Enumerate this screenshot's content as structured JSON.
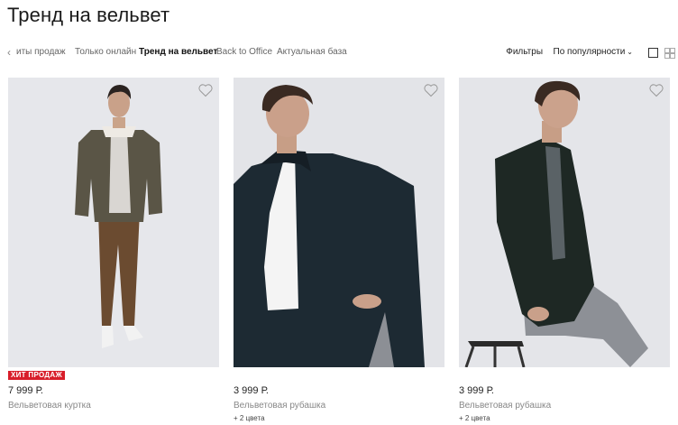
{
  "page": {
    "title": "Тренд на вельвет"
  },
  "tabs": [
    {
      "label": "иты продаж",
      "active": false
    },
    {
      "label": "Только онлайн",
      "active": false
    },
    {
      "label": "Тренд на вельвет",
      "active": true
    },
    {
      "label": "Back to Office",
      "active": false
    },
    {
      "label": "Актуальная база",
      "active": false
    }
  ],
  "icons": {
    "tabs_prev": "chevron-left-icon",
    "sort": "chevron-down-icon",
    "favorite": "heart-icon"
  },
  "controls": {
    "filters_label": "Фильтры",
    "sort_label": "По популярности",
    "view_single": "grid-one-icon",
    "view_multi": "grid-four-icon"
  },
  "products": [
    {
      "badge": "ХИТ ПРОДАЖ",
      "price": "7 999 Р.",
      "name": "Вельветовая куртка",
      "colors": ""
    },
    {
      "badge": "",
      "price": "3 999 Р.",
      "name": "Вельветовая рубашка",
      "colors": "+ 2 цвета"
    },
    {
      "badge": "",
      "price": "3 999 Р.",
      "name": "Вельветовая рубашка",
      "colors": "+ 2 цвета"
    }
  ],
  "colors": {
    "badge_bg": "#d81e2a",
    "photo_bg": "#e4e5e9",
    "text_primary": "#222222",
    "text_muted": "#888888"
  }
}
